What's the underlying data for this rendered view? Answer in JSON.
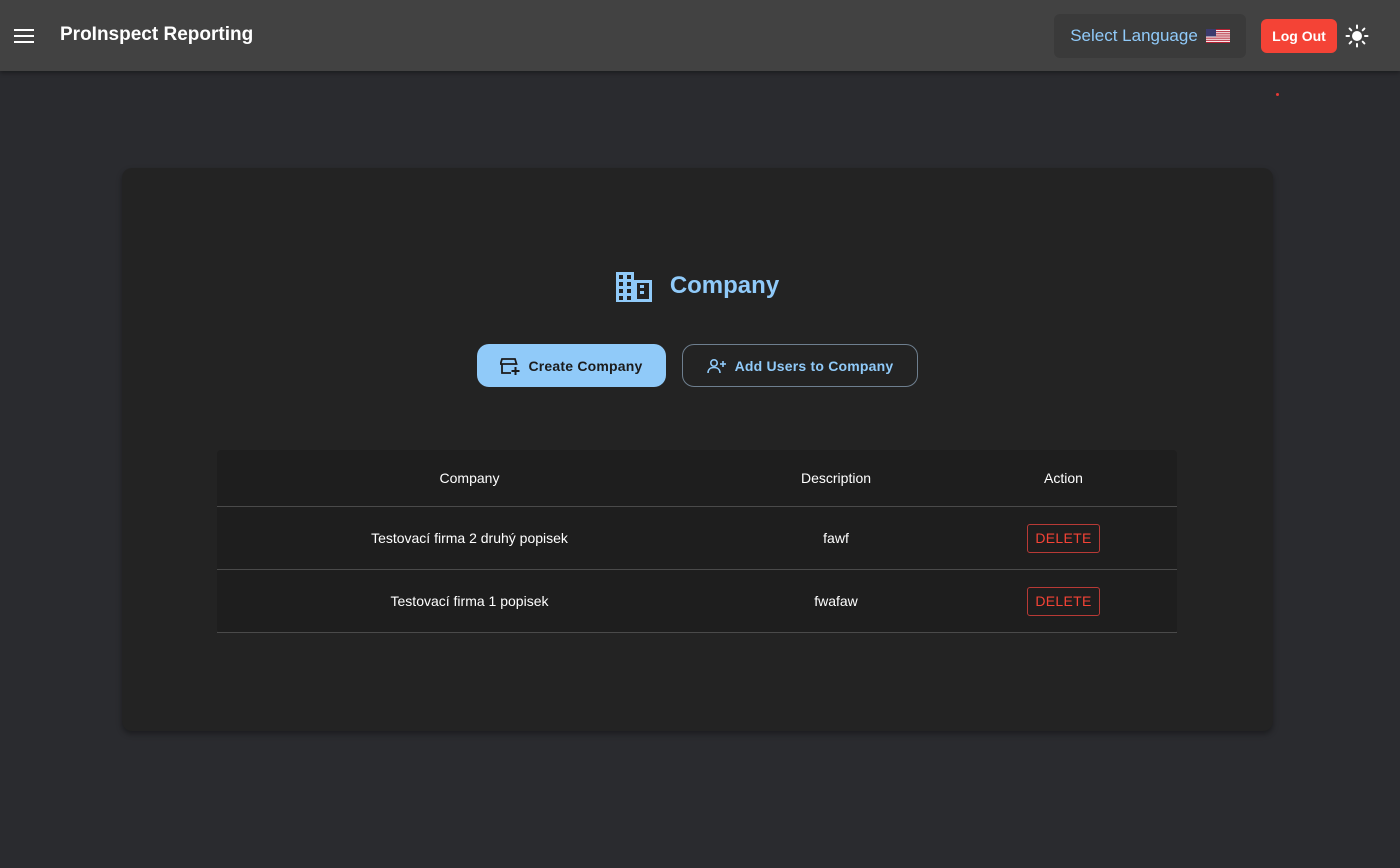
{
  "app": {
    "title": "ProInspect Reporting",
    "select_language_label": "Select Language",
    "logout_label": "Log Out"
  },
  "page": {
    "heading": "Company",
    "create_button_label": "Create Company",
    "add_users_button_label": "Add Users to Company"
  },
  "table": {
    "headers": [
      "Company",
      "Description",
      "Action"
    ],
    "rows": [
      {
        "company": "Testovací firma 2 druhý popisek",
        "description": "fawf",
        "action": "DELETE"
      },
      {
        "company": "Testovací firma 1 popisek",
        "description": "fwafaw",
        "action": "DELETE"
      }
    ]
  },
  "icons": {
    "menu": "menu-icon",
    "flag": "us-flag-icon",
    "theme": "sun-icon",
    "heading": "building-icon",
    "create": "add-business-icon",
    "add_users": "person-add-icon"
  },
  "colors": {
    "accent": "#90caf9",
    "danger": "#f44336",
    "appbar": "#424242",
    "background": "#2a2b2f",
    "card": "#232323"
  }
}
